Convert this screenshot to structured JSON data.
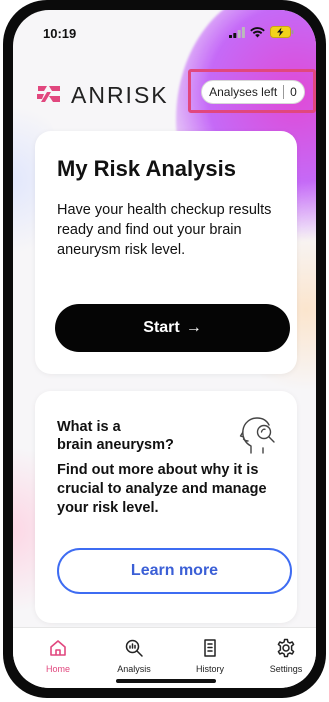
{
  "status_bar": {
    "time": "10:19"
  },
  "brand": {
    "name": "ANRISK",
    "accent_color": "#e1477e"
  },
  "analyses": {
    "label": "Analyses left",
    "count": "0"
  },
  "risk_card": {
    "title": "My Risk Analysis",
    "description": "Have your health checkup results ready and find out your brain aneurysm risk level.",
    "start_label": "Start",
    "start_arrow": "→"
  },
  "aneurysm_card": {
    "title_line1": "What is a",
    "title_line2": "brain aneurysm?",
    "description": "Find out more about why it is crucial to analyze and manage your risk level.",
    "learn_more_label": "Learn more",
    "icon": "head-magnifier-icon"
  },
  "tabbar": {
    "items": [
      {
        "label": "Home",
        "icon": "home-icon",
        "active": true
      },
      {
        "label": "Analysis",
        "icon": "analysis-icon",
        "active": false
      },
      {
        "label": "History",
        "icon": "history-icon",
        "active": false
      },
      {
        "label": "Settings",
        "icon": "settings-icon",
        "active": false
      }
    ],
    "active_color": "#e1477e"
  },
  "colors": {
    "highlight_border": "#e1477e",
    "learn_more_blue": "#3e6cf2",
    "start_button": "#050505"
  }
}
